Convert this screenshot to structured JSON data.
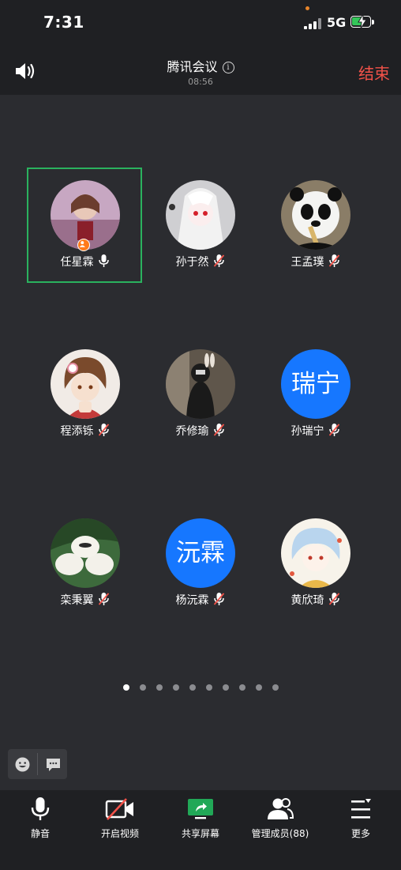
{
  "status_bar": {
    "time": "7:31",
    "network": "5G"
  },
  "meeting": {
    "title": "腾讯会议",
    "duration": "08:56",
    "end_label": "结束"
  },
  "participants": [
    {
      "name": "任星霖",
      "avatar": "photo",
      "mic": "on",
      "host": true,
      "active": true
    },
    {
      "name": "孙于然",
      "avatar": "photo",
      "mic": "muted"
    },
    {
      "name": "王孟璞",
      "avatar": "photo",
      "mic": "muted"
    },
    {
      "name": "程添铄",
      "avatar": "photo",
      "mic": "muted"
    },
    {
      "name": "乔修瑜",
      "avatar": "photo",
      "mic": "muted"
    },
    {
      "name": "孙瑞宁",
      "avatar": "瑞宁",
      "mic": "muted"
    },
    {
      "name": "栾秉翼",
      "avatar": "photo",
      "mic": "muted"
    },
    {
      "name": "杨沅霖",
      "avatar": "沅霖",
      "mic": "muted"
    },
    {
      "name": "黄欣琦",
      "avatar": "photo",
      "mic": "muted"
    }
  ],
  "pagination": {
    "total_pages": 10,
    "current_page": 1
  },
  "toolbar": {
    "mute_label": "静音",
    "video_label": "开启视频",
    "share_label": "共享屏幕",
    "members_label": "管理成员(88)",
    "more_label": "更多"
  },
  "colors": {
    "accent": "#1677ff",
    "active_border": "#2ab25e",
    "end": "#f25249",
    "share": "#21a857",
    "mute_slash": "#f25249"
  }
}
